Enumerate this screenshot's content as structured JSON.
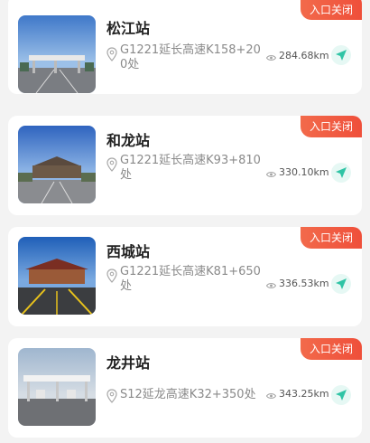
{
  "stations": [
    {
      "name": "松江站",
      "status": "入口关闭",
      "address": "G1221延长高速K158+200处",
      "distance": "284.68km"
    },
    {
      "name": "和龙站",
      "status": "入口关闭",
      "address": "G1221延长高速K93+810处",
      "distance": "330.10km"
    },
    {
      "name": "西城站",
      "status": "入口关闭",
      "address": "G1221延长高速K81+650处",
      "distance": "336.53km"
    },
    {
      "name": "龙井站",
      "status": "入口关闭",
      "address": "S12延龙高速K32+350处",
      "distance": "343.25km"
    }
  ],
  "colors": {
    "badge": "#ef4f3a",
    "nav_accent": "#2fc4a5",
    "card_bg": "#ffffff",
    "page_bg": "#f3f3f3"
  },
  "icons": {
    "location": "location-pin-icon",
    "distance": "eye-icon",
    "navigate": "navigate-arrow-icon"
  }
}
